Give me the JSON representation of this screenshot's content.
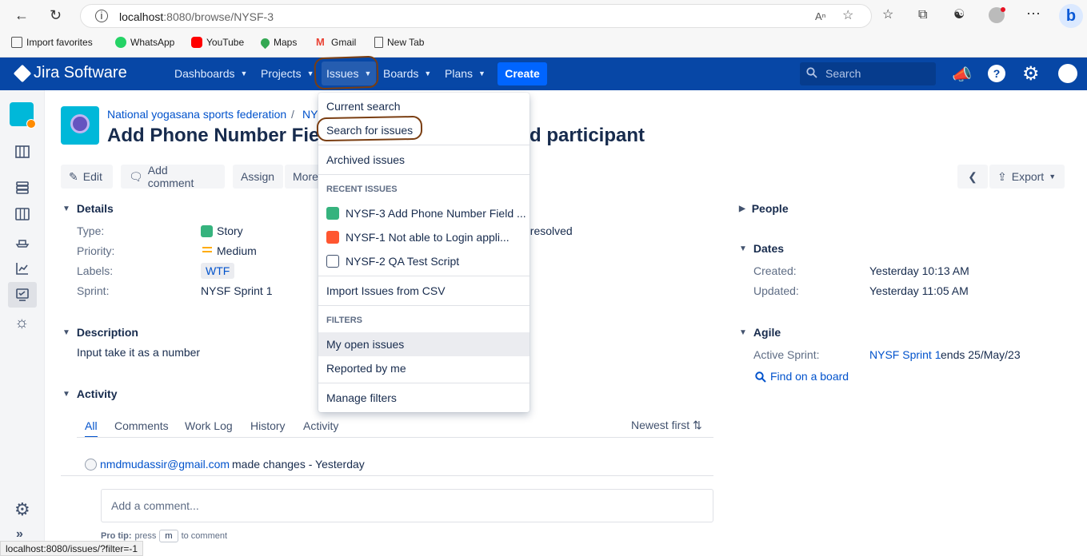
{
  "browser": {
    "url_host": "localhost",
    "url_rest": ":8080/browse/NYSF-3",
    "bookmarks": [
      "Import favorites",
      "WhatsApp",
      "YouTube",
      "Maps",
      "Gmail",
      "New Tab"
    ],
    "status_url": "localhost:8080/issues/?filter=-1"
  },
  "nav": {
    "logo": "Jira Software",
    "items": [
      "Dashboards",
      "Projects",
      "Issues",
      "Boards",
      "Plans"
    ],
    "create": "Create",
    "search_placeholder": "Search"
  },
  "breadcrumb": {
    "project": "National yogasana sports federation",
    "separator": "/",
    "key": "NY"
  },
  "issue": {
    "title_left": "Add Phone Number Fiel",
    "title_right": "d participant",
    "buttons": [
      "Edit",
      "Add comment",
      "Assign",
      "More"
    ],
    "export": "Export"
  },
  "details": {
    "heading": "Details",
    "rows": [
      {
        "label": "Type:",
        "value": "Story"
      },
      {
        "label": "Priority:",
        "value": "Medium"
      },
      {
        "label": "Labels:",
        "value": "WTF"
      },
      {
        "label": "Sprint:",
        "value": "NYSF Sprint 1"
      }
    ],
    "resolution_partial": "nresolved"
  },
  "description": {
    "heading": "Description",
    "text": "Input take it as a number"
  },
  "activity": {
    "heading": "Activity",
    "tabs": [
      "All",
      "Comments",
      "Work Log",
      "History",
      "Activity"
    ],
    "sort": "Newest first",
    "entry_user": "nmdmudassir@gmail.com",
    "entry_text": "made changes - Yesterday",
    "comment_placeholder": "Add a comment...",
    "pro_tip_label": "Pro tip:",
    "pro_tip_text1": "press",
    "pro_tip_key": "m",
    "pro_tip_text2": "to comment"
  },
  "people": {
    "heading": "People"
  },
  "dates": {
    "heading": "Dates",
    "created_label": "Created:",
    "created": "Yesterday 10:13 AM",
    "updated_label": "Updated:",
    "updated": "Yesterday 11:05 AM"
  },
  "agile": {
    "heading": "Agile",
    "active_label": "Active Sprint:",
    "sprint_link": "NYSF Sprint 1",
    "sprint_end": "ends 25/May/23",
    "find": "Find on a board"
  },
  "dropdown": {
    "current_search": "Current search",
    "search_for_issues": "Search for issues",
    "archived": "Archived issues",
    "recent_heading": "RECENT ISSUES",
    "recent": [
      {
        "text": "NYSF-3 Add Phone Number Field ...",
        "color": "#36b37e"
      },
      {
        "text": "NYSF-1 Not able to Login appli...",
        "color": "#ff5630"
      },
      {
        "text": "NYSF-2 QA Test Script",
        "color": "#ffffff"
      }
    ],
    "import_csv": "Import Issues from CSV",
    "filters_heading": "FILTERS",
    "filters": [
      "My open issues",
      "Reported by me"
    ],
    "manage": "Manage filters"
  },
  "colors": {
    "nav": "#0747a6",
    "create": "#0065ff",
    "link": "#0052cc",
    "annotation": "#7a3e12"
  }
}
